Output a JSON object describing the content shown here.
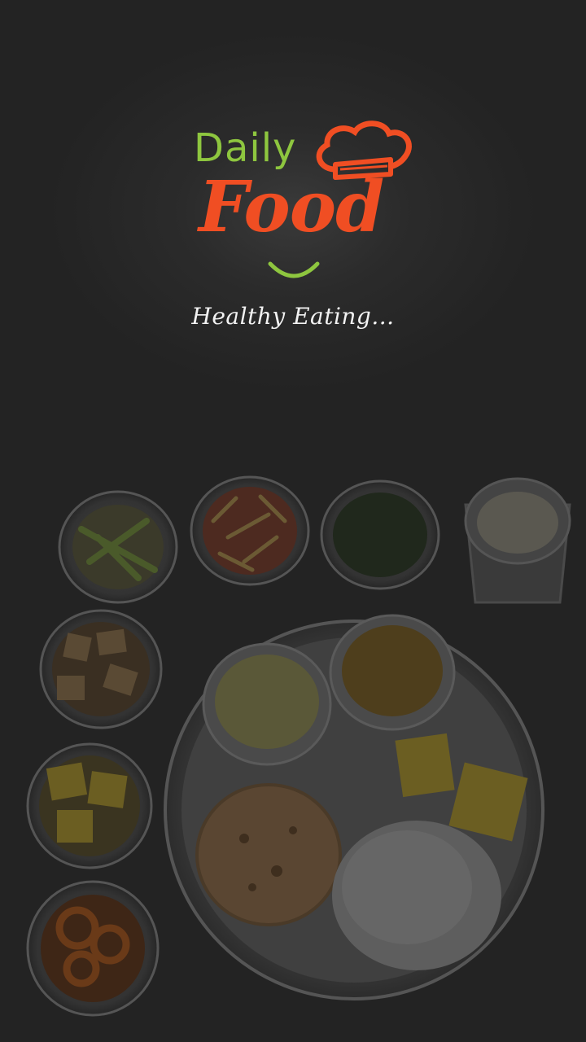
{
  "brand": {
    "line1": "Daily",
    "line2": "Food",
    "tagline": "Healthy Eating...",
    "colors": {
      "green": "#8ec63f",
      "orange": "#f04e23",
      "background": "#232323"
    }
  },
  "icons": {
    "hat": "chef-hat-icon",
    "smile": "smile-icon"
  }
}
